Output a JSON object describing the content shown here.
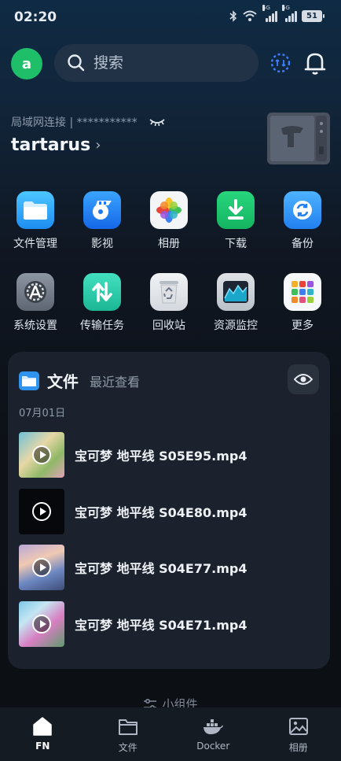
{
  "status_bar": {
    "time": "02:20",
    "signal1_tag": "5G",
    "signal2_tag": "5G",
    "battery": "51"
  },
  "header": {
    "avatar_letter": "a",
    "search_placeholder": "搜索"
  },
  "device": {
    "connection": "局域网连接 | ***********",
    "name": "tartarus"
  },
  "apps": [
    {
      "label": "文件管理",
      "icon": "folder-icon"
    },
    {
      "label": "影视",
      "icon": "film-icon"
    },
    {
      "label": "相册",
      "icon": "photos-icon"
    },
    {
      "label": "下载",
      "icon": "download-icon"
    },
    {
      "label": "备份",
      "icon": "backup-icon"
    },
    {
      "label": "系统设置",
      "icon": "settings-icon"
    },
    {
      "label": "传输任务",
      "icon": "transfer-icon"
    },
    {
      "label": "回收站",
      "icon": "recycle-bin-icon"
    },
    {
      "label": "资源监控",
      "icon": "monitor-icon"
    },
    {
      "label": "更多",
      "icon": "more-apps-icon"
    }
  ],
  "files_card": {
    "title": "文件",
    "subtitle": "最近查看",
    "date": "07月01日",
    "files": [
      {
        "name": "宝可梦 地平线 S05E95.mp4"
      },
      {
        "name": "宝可梦 地平线 S04E80.mp4"
      },
      {
        "name": "宝可梦 地平线 S04E77.mp4"
      },
      {
        "name": "宝可梦 地平线 S04E71.mp4"
      }
    ]
  },
  "widgets_label": "小组件",
  "bottom_nav": [
    {
      "label": "FN",
      "icon": "home-icon",
      "active": true
    },
    {
      "label": "文件",
      "icon": "folder-outline-icon",
      "active": false
    },
    {
      "label": "Docker",
      "icon": "docker-icon",
      "active": false
    },
    {
      "label": "相册",
      "icon": "image-icon",
      "active": false
    }
  ],
  "colors": {
    "accent_green": "#1fbf6a",
    "card_bg": "#1b222d",
    "nav_bg": "#151b23"
  }
}
